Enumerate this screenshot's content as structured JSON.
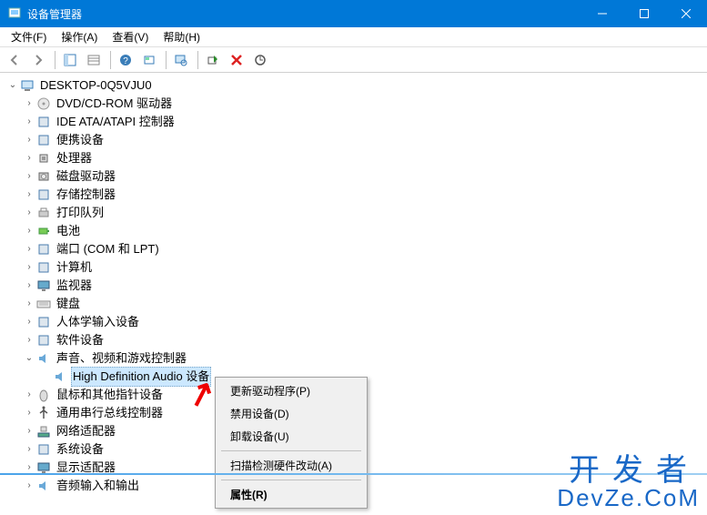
{
  "titlebar": {
    "title": "设备管理器"
  },
  "menubar": {
    "items": [
      {
        "label": "文件(F)"
      },
      {
        "label": "操作(A)"
      },
      {
        "label": "查看(V)"
      },
      {
        "label": "帮助(H)"
      }
    ]
  },
  "toolbar_icons": [
    "back",
    "forward",
    "sep",
    "show-grid",
    "properties",
    "sep",
    "help",
    "refresh",
    "sep",
    "scan-monitor",
    "sep",
    "add-legacy",
    "remove",
    "update"
  ],
  "tree": {
    "root": {
      "label": "DESKTOP-0Q5VJU0",
      "icon": "computer-icon",
      "expanded": true
    },
    "children": [
      {
        "label": "DVD/CD-ROM 驱动器",
        "icon": "disc-icon",
        "expanded": false,
        "has_children": true
      },
      {
        "label": "IDE ATA/ATAPI 控制器",
        "icon": "ide-icon",
        "expanded": false,
        "has_children": true
      },
      {
        "label": "便携设备",
        "icon": "portable-icon",
        "expanded": false,
        "has_children": true
      },
      {
        "label": "处理器",
        "icon": "cpu-icon",
        "expanded": false,
        "has_children": true
      },
      {
        "label": "磁盘驱动器",
        "icon": "disk-icon",
        "expanded": false,
        "has_children": true
      },
      {
        "label": "存储控制器",
        "icon": "storage-icon",
        "expanded": false,
        "has_children": true
      },
      {
        "label": "打印队列",
        "icon": "printer-icon",
        "expanded": false,
        "has_children": true
      },
      {
        "label": "电池",
        "icon": "battery-icon",
        "expanded": false,
        "has_children": true
      },
      {
        "label": "端口 (COM 和 LPT)",
        "icon": "port-icon",
        "expanded": false,
        "has_children": true
      },
      {
        "label": "计算机",
        "icon": "pc-icon",
        "expanded": false,
        "has_children": true
      },
      {
        "label": "监视器",
        "icon": "monitor-icon",
        "expanded": false,
        "has_children": true
      },
      {
        "label": "键盘",
        "icon": "keyboard-icon",
        "expanded": false,
        "has_children": true
      },
      {
        "label": "人体学输入设备",
        "icon": "hid-icon",
        "expanded": false,
        "has_children": true
      },
      {
        "label": "软件设备",
        "icon": "software-icon",
        "expanded": false,
        "has_children": true
      },
      {
        "label": "声音、视频和游戏控制器",
        "icon": "audio-icon",
        "expanded": true,
        "has_children": true,
        "children": [
          {
            "label": "High Definition Audio 设备",
            "icon": "speaker-icon",
            "selected": true
          }
        ]
      },
      {
        "label": "鼠标和其他指针设备",
        "icon": "mouse-icon",
        "expanded": false,
        "has_children": true
      },
      {
        "label": "通用串行总线控制器",
        "icon": "usb-icon",
        "expanded": false,
        "has_children": true
      },
      {
        "label": "网络适配器",
        "icon": "network-icon",
        "expanded": false,
        "has_children": true
      },
      {
        "label": "系统设备",
        "icon": "system-icon",
        "expanded": false,
        "has_children": true
      },
      {
        "label": "显示适配器",
        "icon": "display-icon",
        "expanded": false,
        "has_children": true
      },
      {
        "label": "音频输入和输出",
        "icon": "audio-io-icon",
        "expanded": false,
        "has_children": true
      }
    ]
  },
  "context_menu": {
    "items": [
      {
        "label": "更新驱动程序(P)",
        "type": "item"
      },
      {
        "label": "禁用设备(D)",
        "type": "item"
      },
      {
        "label": "卸载设备(U)",
        "type": "item"
      },
      {
        "type": "sep"
      },
      {
        "label": "扫描检测硬件改动(A)",
        "type": "item"
      },
      {
        "type": "sep"
      },
      {
        "label": "属性(R)",
        "type": "item",
        "bold": true
      }
    ]
  },
  "watermark": {
    "cn": "开发者",
    "en": "DevZe.CoM"
  }
}
